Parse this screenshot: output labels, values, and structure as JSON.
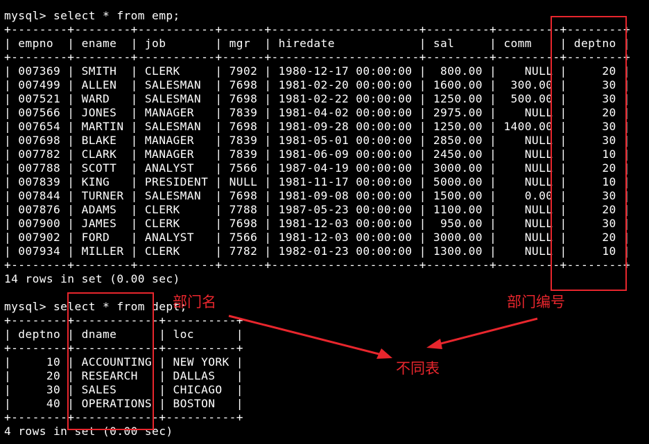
{
  "terminal": {
    "query1": {
      "prompt": "mysql> select * from emp;",
      "border": "+--------+--------+-----------+------+---------------------+---------+---------+--------+",
      "header": "| empno  | ename  | job       | mgr  | hiredate            | sal     | comm    | deptno |",
      "rows": [
        "| 007369 | SMITH  | CLERK     | 7902 | 1980-12-17 00:00:00 |  800.00 |    NULL |     20 |",
        "| 007499 | ALLEN  | SALESMAN  | 7698 | 1981-02-20 00:00:00 | 1600.00 |  300.00 |     30 |",
        "| 007521 | WARD   | SALESMAN  | 7698 | 1981-02-22 00:00:00 | 1250.00 |  500.00 |     30 |",
        "| 007566 | JONES  | MANAGER   | 7839 | 1981-04-02 00:00:00 | 2975.00 |    NULL |     20 |",
        "| 007654 | MARTIN | SALESMAN  | 7698 | 1981-09-28 00:00:00 | 1250.00 | 1400.00 |     30 |",
        "| 007698 | BLAKE  | MANAGER   | 7839 | 1981-05-01 00:00:00 | 2850.00 |    NULL |     30 |",
        "| 007782 | CLARK  | MANAGER   | 7839 | 1981-06-09 00:00:00 | 2450.00 |    NULL |     10 |",
        "| 007788 | SCOTT  | ANALYST   | 7566 | 1987-04-19 00:00:00 | 3000.00 |    NULL |     20 |",
        "| 007839 | KING   | PRESIDENT | NULL | 1981-11-17 00:00:00 | 5000.00 |    NULL |     10 |",
        "| 007844 | TURNER | SALESMAN  | 7698 | 1981-09-08 00:00:00 | 1500.00 |    0.00 |     30 |",
        "| 007876 | ADAMS  | CLERK     | 7788 | 1987-05-23 00:00:00 | 1100.00 |    NULL |     20 |",
        "| 007900 | JAMES  | CLERK     | 7698 | 1981-12-03 00:00:00 |  950.00 |    NULL |     30 |",
        "| 007902 | FORD   | ANALYST   | 7566 | 1981-12-03 00:00:00 | 3000.00 |    NULL |     20 |",
        "| 007934 | MILLER | CLERK     | 7782 | 1982-01-23 00:00:00 | 1300.00 |    NULL |     10 |"
      ],
      "summary": "14 rows in set (0.00 sec)"
    },
    "query2": {
      "prompt": "mysql> select * from dept;",
      "border": "+--------+------------+----------+",
      "header": "| deptno | dname      | loc      |",
      "rows": [
        "|     10 | ACCOUNTING | NEW YORK |",
        "|     20 | RESEARCH   | DALLAS   |",
        "|     30 | SALES      | CHICAGO  |",
        "|     40 | OPERATIONS | BOSTON   |"
      ],
      "summary": "4 rows in set (0.00 sec)"
    }
  },
  "annotations": {
    "dept_name_label": "部门名",
    "dept_no_label": "部门编号",
    "different_tables_label": "不同表",
    "accent_color": "#e8262d"
  }
}
